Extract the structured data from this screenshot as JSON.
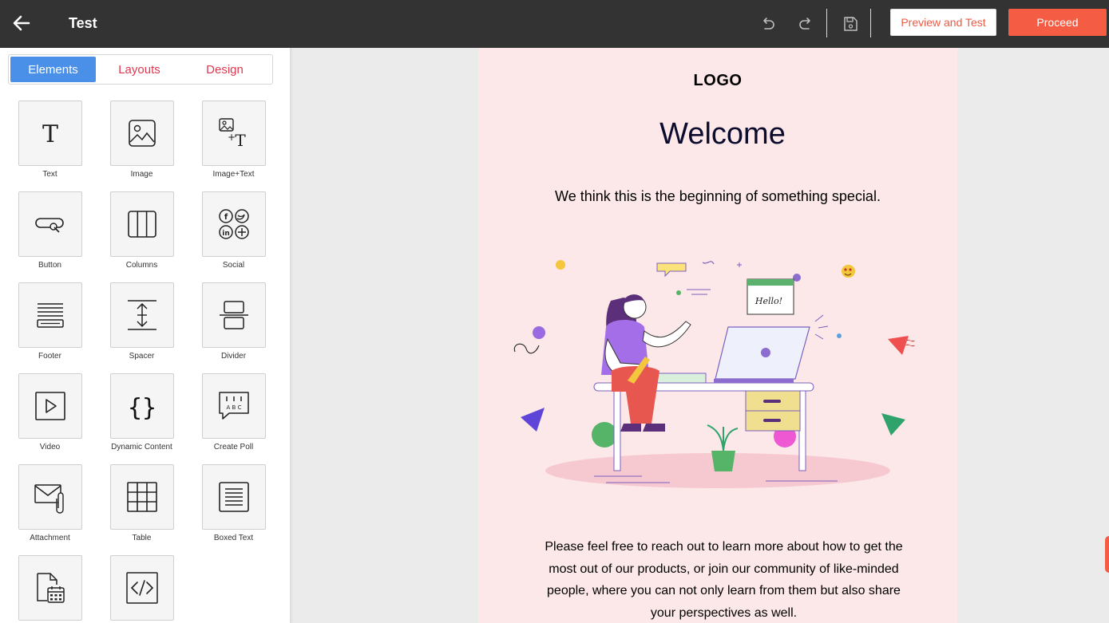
{
  "header": {
    "title": "Test",
    "preview_label": "Preview and Test",
    "proceed_label": "Proceed",
    "accent_color": "#f45c43"
  },
  "sidebar": {
    "tabs": [
      {
        "label": "Elements",
        "active": true
      },
      {
        "label": "Layouts",
        "active": false
      },
      {
        "label": "Design",
        "active": false
      }
    ],
    "elements": [
      {
        "label": "Text",
        "icon": "text-icon"
      },
      {
        "label": "Image",
        "icon": "image-icon"
      },
      {
        "label": "Image+Text",
        "icon": "image-text-icon"
      },
      {
        "label": "Button",
        "icon": "button-icon"
      },
      {
        "label": "Columns",
        "icon": "columns-icon"
      },
      {
        "label": "Social",
        "icon": "social-icon"
      },
      {
        "label": "Footer",
        "icon": "footer-icon"
      },
      {
        "label": "Spacer",
        "icon": "spacer-icon"
      },
      {
        "label": "Divider",
        "icon": "divider-icon"
      },
      {
        "label": "Video",
        "icon": "video-icon"
      },
      {
        "label": "Dynamic Content",
        "icon": "dynamic-content-icon"
      },
      {
        "label": "Create Poll",
        "icon": "poll-icon"
      },
      {
        "label": "Attachment",
        "icon": "attachment-icon"
      },
      {
        "label": "Table",
        "icon": "table-icon"
      },
      {
        "label": "Boxed Text",
        "icon": "boxed-text-icon"
      },
      {
        "label": "",
        "icon": "calendar-file-icon"
      },
      {
        "label": "",
        "icon": "html-code-icon"
      }
    ]
  },
  "email": {
    "logo": "LOGO",
    "heading": "Welcome",
    "tagline": "We think this is the beginning of something special.",
    "illustration_text": "Hello!",
    "body": "Please feel free to reach out to learn more about how to get the most out of our products, or join our community of like-minded people, where you can not only learn from them but also share your perspectives as well.",
    "background_color": "#fce8e8"
  }
}
